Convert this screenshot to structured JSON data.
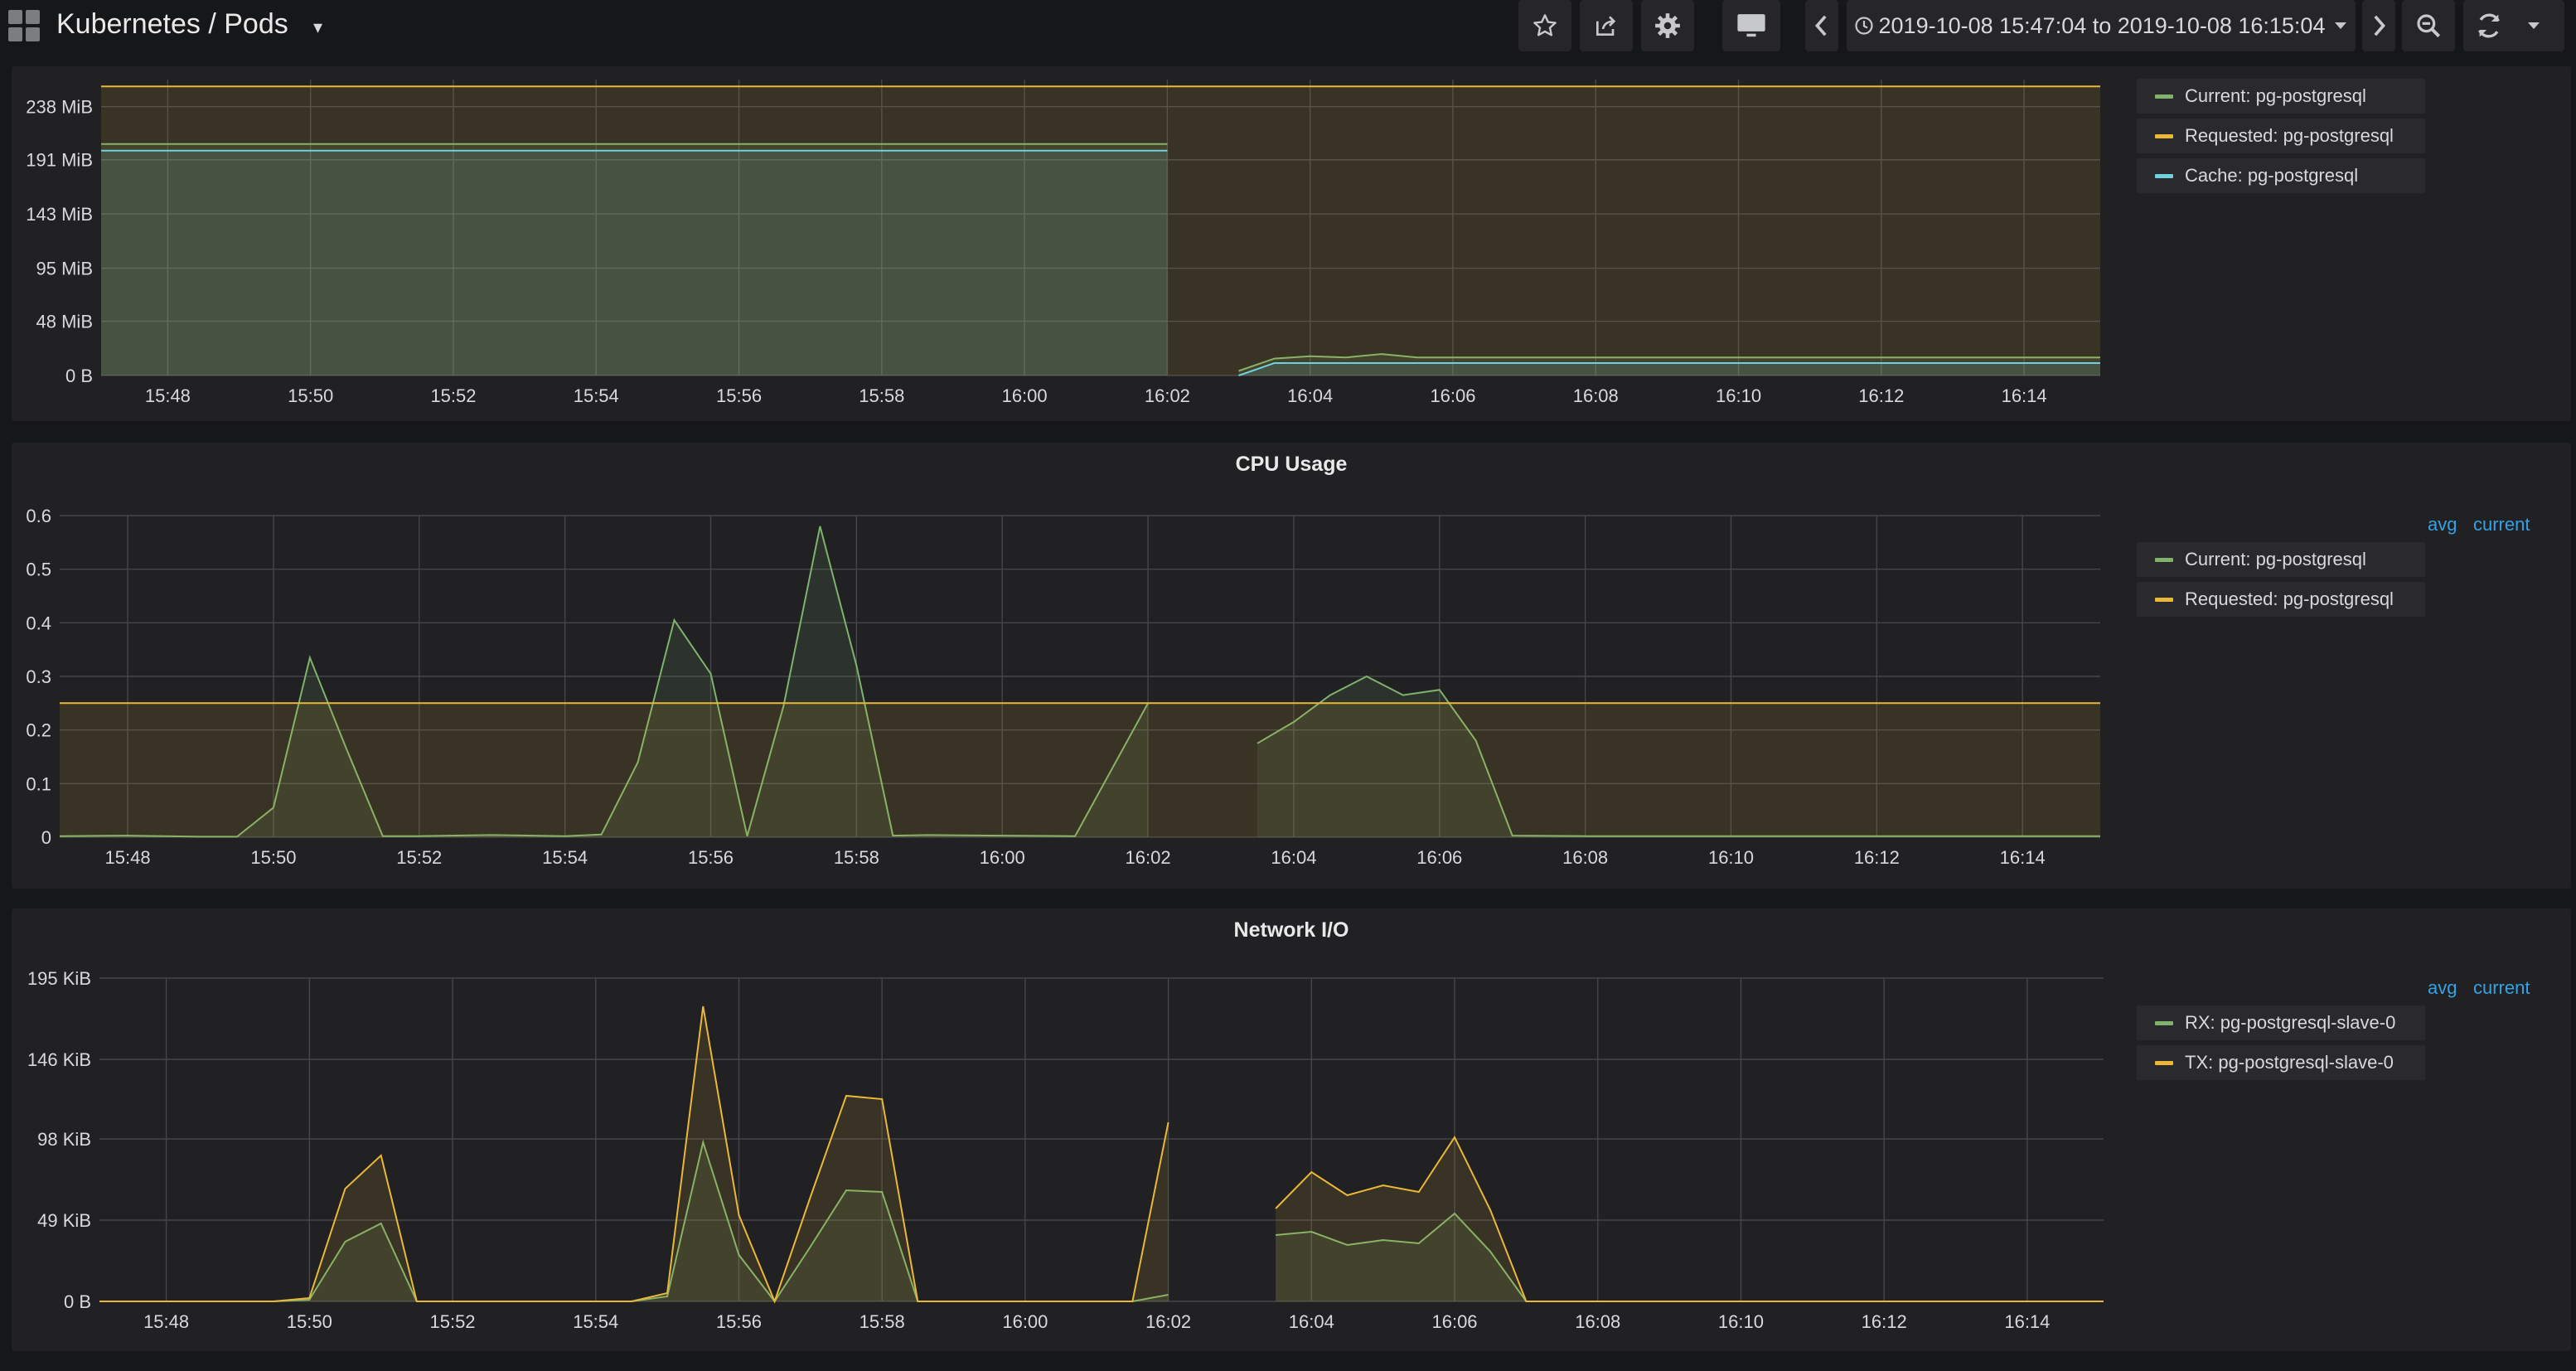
{
  "header": {
    "title": "Kubernetes / Pods",
    "time_range": "2019-10-08 15:47:04 to 2019-10-08 16:15:04",
    "icons": [
      "dashboard-grid-icon",
      "caret-down-icon",
      "star-icon",
      "share-icon",
      "gear-icon",
      "monitor-icon",
      "chevron-left-icon",
      "clock-icon",
      "chevron-right-icon",
      "zoom-out-icon",
      "refresh-icon"
    ]
  },
  "colors": {
    "current": "#7eb26d",
    "requested": "#eab839",
    "cache": "#6ed0e0",
    "rx": "#7eb26d",
    "tx": "#eab839",
    "link": "#33a2e5",
    "panel_bg": "#212124",
    "grid": "#464649"
  },
  "panels": {
    "memory": {
      "legend": [
        "Current: pg-postgresql",
        "Requested: pg-postgresql",
        "Cache: pg-postgresql"
      ]
    },
    "cpu": {
      "title": "CPU Usage",
      "legend_headers": [
        "avg",
        "current"
      ],
      "legend": [
        "Current: pg-postgresql",
        "Requested: pg-postgresql"
      ]
    },
    "network": {
      "title": "Network I/O",
      "legend_headers": [
        "avg",
        "current"
      ],
      "legend": [
        "RX: pg-postgresql-slave-0",
        "TX: pg-postgresql-slave-0"
      ]
    }
  },
  "chart_data": [
    {
      "type": "area",
      "x_ticks": [
        "15:48",
        "15:50",
        "15:52",
        "15:54",
        "15:56",
        "15:58",
        "16:00",
        "16:02",
        "16:04",
        "16:06",
        "16:08",
        "16:10",
        "16:12",
        "16:14"
      ],
      "y_ticks": [
        "0 B",
        "48 MiB",
        "95 MiB",
        "143 MiB",
        "191 MiB",
        "238 MiB"
      ],
      "xlim": [
        "15:47:04",
        "16:15:04"
      ],
      "ylim_mib": [
        0,
        262
      ],
      "series": [
        {
          "name": "Current: pg-postgresql",
          "color": "#7eb26d",
          "x": [
            "15:47:04",
            "15:49",
            "15:51",
            "15:53",
            "15:55",
            "15:57",
            "15:59",
            "16:01",
            "16:02",
            "16:02",
            "16:03",
            "16:03:30",
            "16:04",
            "16:04:30",
            "16:05",
            "16:05:30",
            "16:06",
            "16:08",
            "16:10",
            "16:12",
            "16:14",
            "16:15:04"
          ],
          "y": [
            205,
            205,
            205,
            205,
            205,
            205,
            205,
            205,
            205,
            null,
            4,
            15,
            17,
            16,
            19,
            16,
            16,
            16,
            16,
            16,
            16,
            16
          ]
        },
        {
          "name": "Requested: pg-postgresql",
          "color": "#eab839",
          "x": [
            "15:47:04",
            "16:15:04"
          ],
          "y": [
            256,
            256
          ]
        },
        {
          "name": "Cache: pg-postgresql",
          "color": "#6ed0e0",
          "x": [
            "15:47:04",
            "15:49",
            "15:51",
            "15:53",
            "15:55",
            "15:57",
            "15:59",
            "16:01",
            "16:02",
            "16:02",
            "16:03",
            "16:03:30",
            "16:04",
            "16:06",
            "16:08",
            "16:10",
            "16:12",
            "16:14",
            "16:15:04"
          ],
          "y": [
            199,
            199,
            199,
            199,
            199,
            199,
            199,
            199,
            199,
            null,
            0,
            11,
            11,
            11,
            11,
            11,
            11,
            11,
            11
          ]
        }
      ]
    },
    {
      "type": "area",
      "title": "CPU Usage",
      "x_ticks": [
        "15:48",
        "15:50",
        "15:52",
        "15:54",
        "15:56",
        "15:58",
        "16:00",
        "16:02",
        "16:04",
        "16:06",
        "16:08",
        "16:10",
        "16:12",
        "16:14"
      ],
      "y_ticks": [
        "0",
        "0.1",
        "0.2",
        "0.3",
        "0.4",
        "0.5",
        "0.6"
      ],
      "xlim": [
        "15:47:04",
        "16:15:04"
      ],
      "ylim": [
        0,
        0.6
      ],
      "series": [
        {
          "name": "Current: pg-postgresql",
          "color": "#7eb26d",
          "x": [
            "15:47:04",
            "15:48",
            "15:49",
            "15:49:30",
            "15:50",
            "15:50:30",
            "15:51",
            "15:51:30",
            "15:52",
            "15:53",
            "15:54",
            "15:54:30",
            "15:55",
            "15:55:30",
            "15:56",
            "15:56:30",
            "15:57",
            "15:57:30",
            "15:58",
            "15:58:30",
            "15:59",
            "16:00",
            "16:01",
            "16:02",
            "16:02",
            "16:03:30",
            "16:04",
            "16:04:30",
            "16:05",
            "16:05:30",
            "16:06",
            "16:06:30",
            "16:07",
            "16:08",
            "16:10",
            "16:12",
            "16:14",
            "16:15:04"
          ],
          "y": [
            0.002,
            0.003,
            0.001,
            0.001,
            0.055,
            0.335,
            0.165,
            0.002,
            0.002,
            0.004,
            0.002,
            0.005,
            0.14,
            0.405,
            0.305,
            0.002,
            0.245,
            0.58,
            0.32,
            0.003,
            0.004,
            0.003,
            0.002,
            0.25,
            null,
            0.175,
            0.215,
            0.265,
            0.3,
            0.265,
            0.275,
            0.18,
            0.003,
            0.002,
            0.002,
            0.002,
            0.002,
            0.002
          ]
        },
        {
          "name": "Requested: pg-postgresql",
          "color": "#eab839",
          "x": [
            "15:47:04",
            "16:15:04"
          ],
          "y": [
            0.25,
            0.25
          ]
        }
      ]
    },
    {
      "type": "area",
      "title": "Network I/O",
      "x_ticks": [
        "15:48",
        "15:50",
        "15:52",
        "15:54",
        "15:56",
        "15:58",
        "16:00",
        "16:02",
        "16:04",
        "16:06",
        "16:08",
        "16:10",
        "16:12",
        "16:14"
      ],
      "y_ticks": [
        "0 B",
        "49 KiB",
        "98 KiB",
        "146 KiB",
        "195 KiB"
      ],
      "xlim": [
        "15:47:04",
        "16:15:04"
      ],
      "ylim_kib": [
        0,
        195
      ],
      "series": [
        {
          "name": "RX: pg-postgresql-slave-0",
          "color": "#7eb26d",
          "x": [
            "15:47:04",
            "15:49:30",
            "15:50",
            "15:50:30",
            "15:51",
            "15:51:30",
            "15:52",
            "15:54",
            "15:54:30",
            "15:55",
            "15:55:30",
            "15:56",
            "15:56:30",
            "15:57",
            "15:57:30",
            "15:58",
            "15:58:30",
            "16:00",
            "16:01:30",
            "16:02",
            "16:02",
            "16:03:30",
            "16:04",
            "16:04:30",
            "16:05",
            "16:05:30",
            "16:06",
            "16:06:30",
            "16:07",
            "16:08",
            "16:10",
            "16:12",
            "16:14",
            "16:15:04"
          ],
          "y": [
            0,
            0,
            1,
            36,
            47,
            0,
            0,
            0,
            0,
            3,
            96,
            28,
            0,
            33,
            67,
            66,
            0,
            0,
            0,
            4,
            null,
            40,
            42,
            34,
            37,
            35,
            53,
            30,
            0,
            0,
            0,
            0,
            0,
            0
          ]
        },
        {
          "name": "TX: pg-postgresql-slave-0",
          "color": "#eab839",
          "x": [
            "15:47:04",
            "15:49:30",
            "15:50",
            "15:50:30",
            "15:51",
            "15:51:30",
            "15:52",
            "15:54",
            "15:54:30",
            "15:55",
            "15:55:30",
            "15:56",
            "15:56:30",
            "15:57",
            "15:57:30",
            "15:58",
            "15:58:30",
            "16:00",
            "16:01:30",
            "16:02",
            "16:02",
            "16:03:30",
            "16:04",
            "16:04:30",
            "16:05",
            "16:05:30",
            "16:06",
            "16:06:30",
            "16:07",
            "16:08",
            "16:10",
            "16:12",
            "16:14",
            "16:15:04"
          ],
          "y": [
            0,
            0,
            2,
            68,
            88,
            0,
            0,
            0,
            0,
            5,
            178,
            52,
            0,
            63,
            124,
            122,
            0,
            0,
            0,
            108,
            null,
            56,
            78,
            64,
            70,
            66,
            99,
            55,
            0,
            0,
            0,
            0,
            0,
            0
          ]
        }
      ]
    }
  ]
}
